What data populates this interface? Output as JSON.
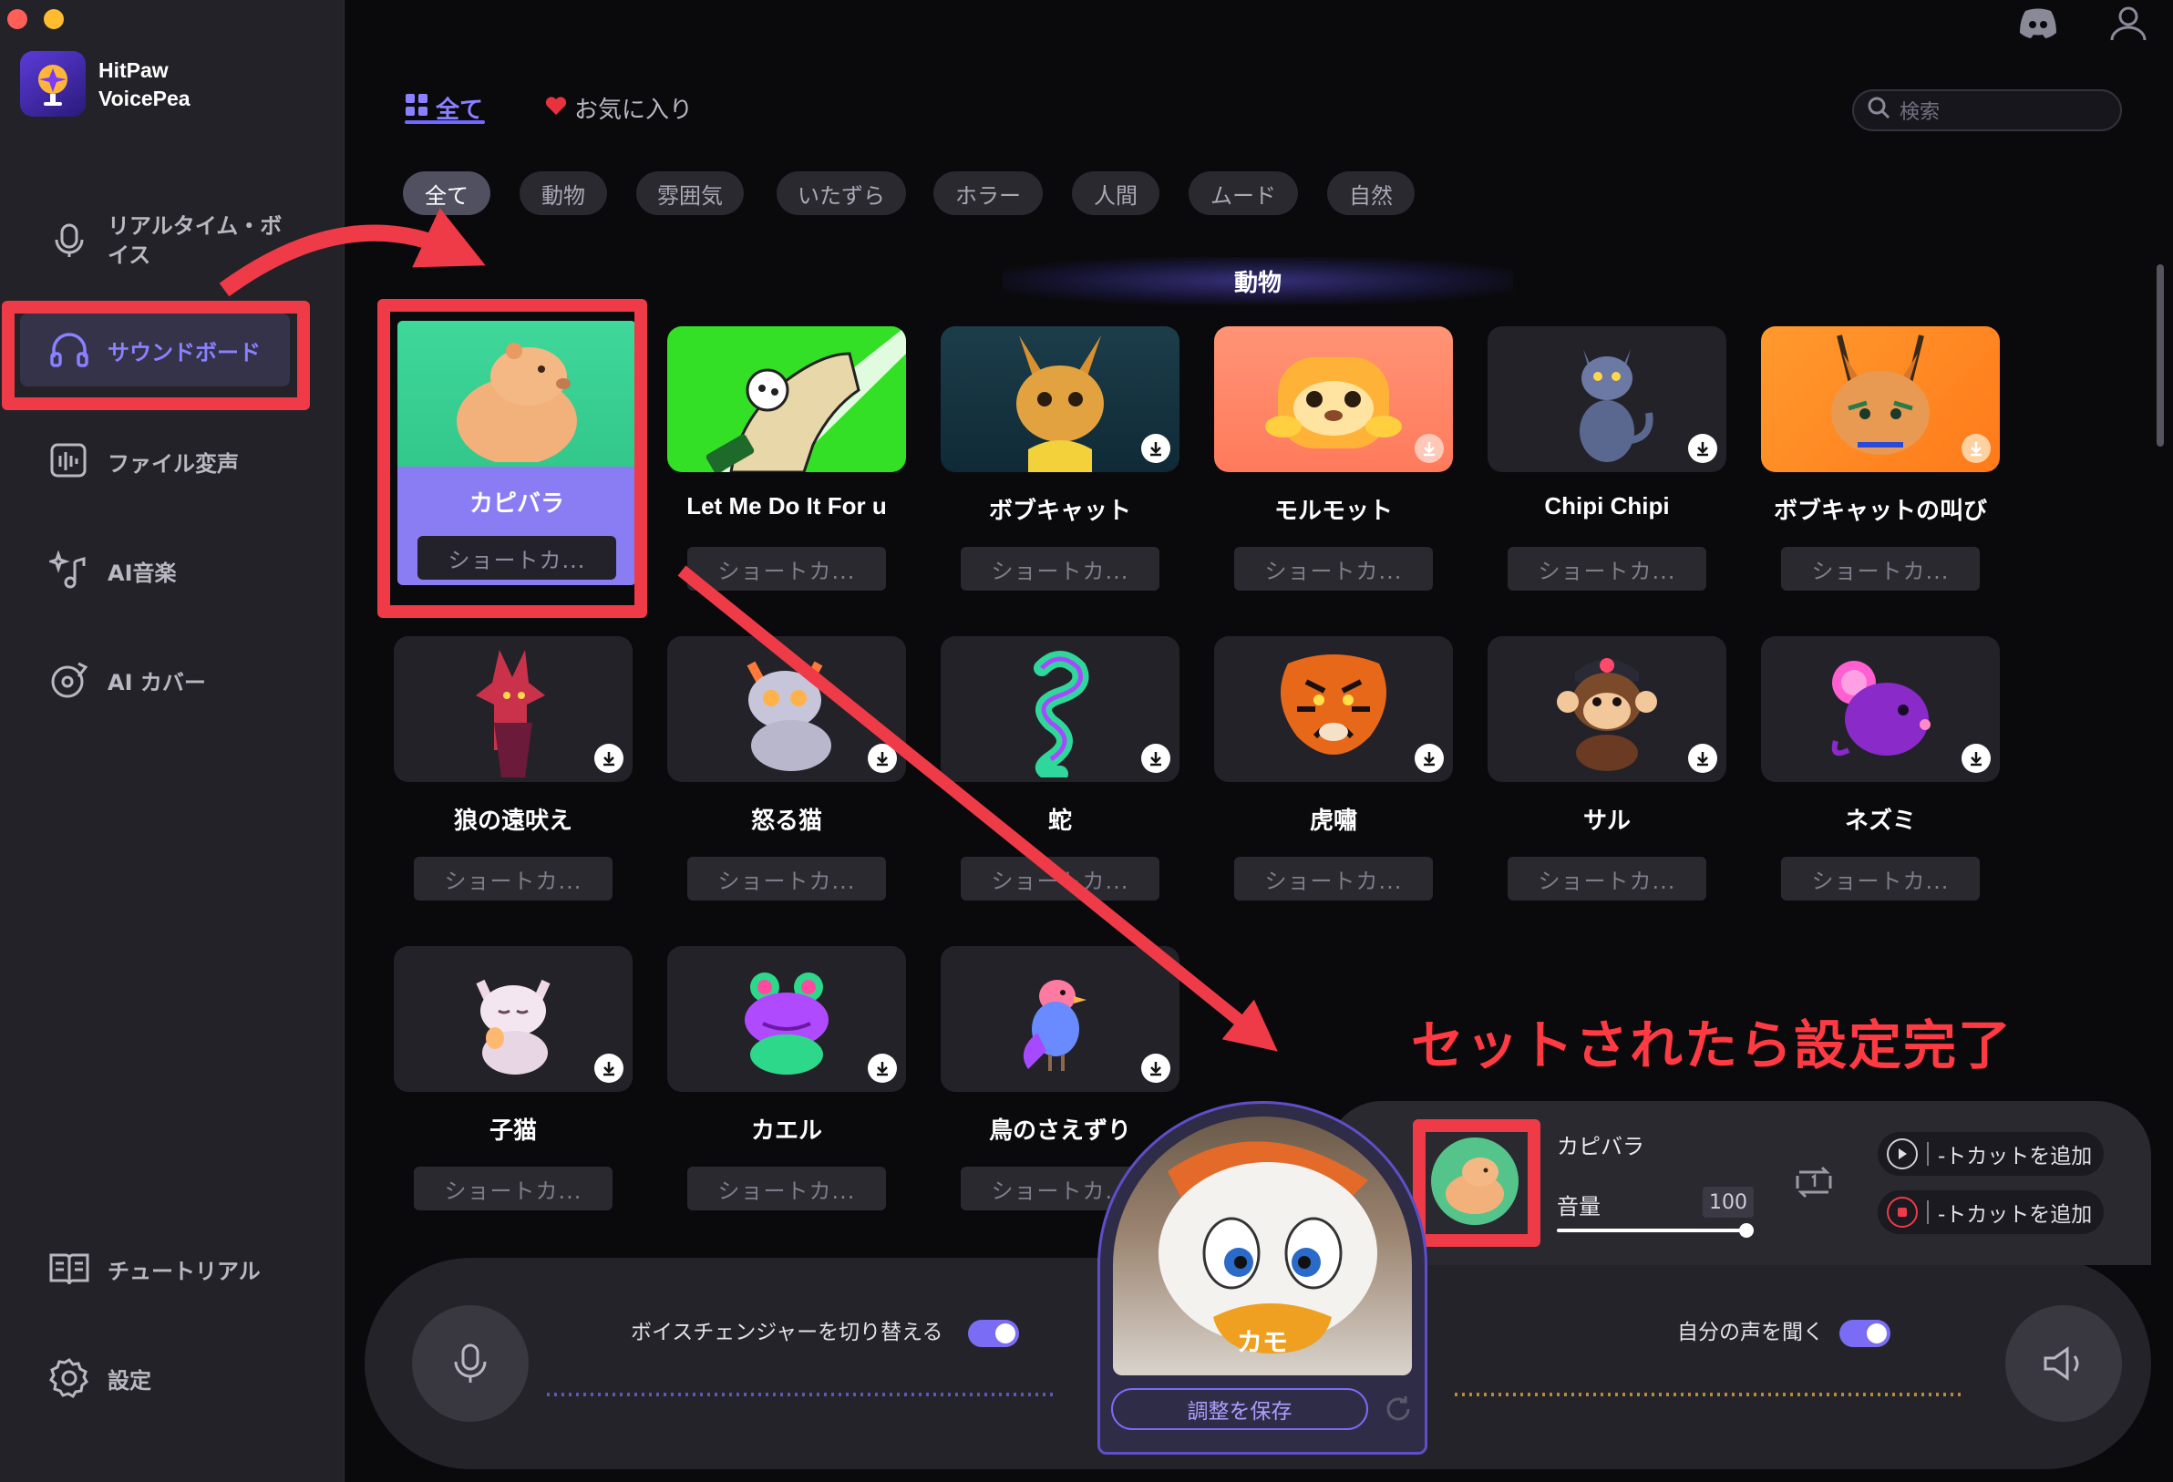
{
  "app": {
    "name_line1": "HitPaw",
    "name_line2": "VoicePea"
  },
  "sidebar": {
    "items": [
      {
        "label_line1": "リアルタイム・ボ",
        "label_line2": "イス"
      },
      {
        "label": "サウンドボード"
      },
      {
        "label": "ファイル変声"
      },
      {
        "label": "AI音楽"
      },
      {
        "label": "AI カバー"
      },
      {
        "label": "チュートリアル"
      },
      {
        "label": "設定"
      }
    ]
  },
  "header": {
    "tabs": [
      {
        "label": "全て"
      },
      {
        "label": "お気に入り"
      }
    ],
    "search_placeholder": "検索"
  },
  "filters": [
    "全て",
    "動物",
    "雰囲気",
    "いたずら",
    "ホラー",
    "人間",
    "ムード",
    "自然"
  ],
  "section_title": "動物",
  "sounds": [
    {
      "name": "カピバラ",
      "shortcut": "ショートカ..."
    },
    {
      "name": "Let Me Do It For u",
      "shortcut": "ショートカ..."
    },
    {
      "name": "ボブキャット",
      "shortcut": "ショートカ..."
    },
    {
      "name": "モルモット",
      "shortcut": "ショートカ..."
    },
    {
      "name": "Chipi Chipi",
      "shortcut": "ショートカ..."
    },
    {
      "name": "ボブキャットの叫び",
      "shortcut": "ショートカ..."
    },
    {
      "name": "狼の遠吠え",
      "shortcut": "ショートカ..."
    },
    {
      "name": "怒る猫",
      "shortcut": "ショートカ..."
    },
    {
      "name": "蛇",
      "shortcut": "ショートカ..."
    },
    {
      "name": "虎嘯",
      "shortcut": "ショートカ..."
    },
    {
      "name": "サル",
      "shortcut": "ショートカ..."
    },
    {
      "name": "ネズミ",
      "shortcut": "ショートカ..."
    },
    {
      "name": "子猫",
      "shortcut": "ショートカ..."
    },
    {
      "name": "カエル",
      "shortcut": "ショートカ..."
    },
    {
      "name": "鳥のさえずり",
      "shortcut": "ショートカ..."
    }
  ],
  "annotation": "セットされたら設定完了",
  "bottom": {
    "voice_changer_label": "ボイスチェンジャーを切り替える",
    "listen_label": "自分の声を聞く",
    "voice_name": "カモ",
    "save_button": "調整を保存",
    "current_sound": "カピバラ",
    "volume_label": "音量",
    "volume_value": "100",
    "volume_level": 1.0,
    "shortcut_play": "-トカットを追加",
    "shortcut_stop": "-トカットを追加"
  },
  "colors": {
    "accent": "#7a6cf5",
    "annotation_red": "#ef3a47",
    "selected_card": "#8a7cf2"
  }
}
